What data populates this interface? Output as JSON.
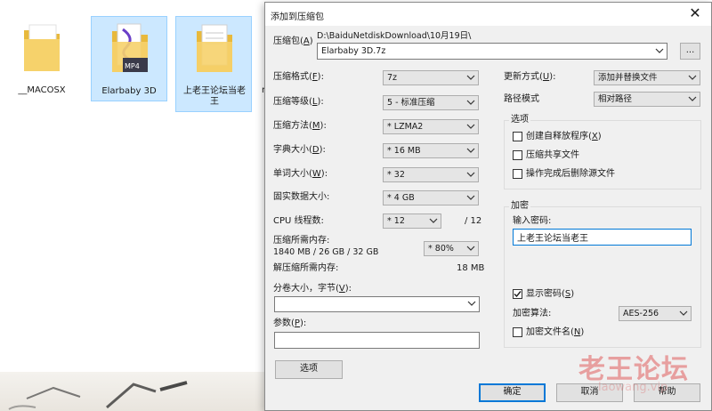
{
  "explorer": {
    "files": [
      {
        "name": "__MACOSX",
        "icon": "folder-icon"
      },
      {
        "name": "Elarbaby 3D",
        "icon": "mp4-folder-icon"
      },
      {
        "name": "上老王论坛当老王",
        "icon": "document-folder-icon"
      }
    ],
    "partial_text": "r"
  },
  "dialog": {
    "title": "添加到压缩包",
    "close_glyph": "✕",
    "archive": {
      "label": "压缩包(",
      "label_key": "A",
      "label_end": ")",
      "path": "D:\\BaiduNetdiskDownload\\10月19日\\",
      "filename": "Elarbaby 3D.7z",
      "browse_label": "..."
    },
    "left": {
      "format": {
        "label": "压缩格式(",
        "key": "F",
        "end": "):",
        "value": "7z"
      },
      "level": {
        "label": "压缩等级(",
        "key": "L",
        "end": "):",
        "value": "5 - 标准压缩"
      },
      "method": {
        "label": "压缩方法(",
        "key": "M",
        "end": "):",
        "value": "* LZMA2"
      },
      "dict": {
        "label": "字典大小(",
        "key": "D",
        "end": "):",
        "value": "* 16 MB"
      },
      "word": {
        "label": "单词大小(",
        "key": "W",
        "end": "):",
        "value": "* 32"
      },
      "solid": {
        "label": "固实数据大小:",
        "value": "* 4 GB"
      },
      "cpu": {
        "label": "CPU 线程数:",
        "value": "* 12",
        "max": "/ 12"
      },
      "mem_compress": {
        "label": "压缩所需内存:",
        "detail": "1840 MB / 26 GB / 32 GB",
        "value": "* 80%"
      },
      "mem_decompress": {
        "label": "解压缩所需内存:",
        "value": "18 MB"
      },
      "split": {
        "label": "分卷大小，字节(",
        "key": "V",
        "end": "):",
        "value": ""
      },
      "params": {
        "label": "参数(",
        "key": "P",
        "end": "):",
        "value": ""
      },
      "options_button": "选项"
    },
    "right": {
      "update": {
        "label": "更新方式(",
        "key": "U",
        "end": "):",
        "value": "添加并替换文件"
      },
      "path_mode": {
        "label": "路径模式",
        "value": "相对路径"
      },
      "options": {
        "title": "选项",
        "sfx": {
          "label": "创建自释放程序(",
          "key": "X",
          "end": ")",
          "checked": false
        },
        "shared": {
          "label": "压缩共享文件",
          "checked": false
        },
        "delete": {
          "label": "操作完成后删除源文件",
          "checked": false
        }
      },
      "encryption": {
        "title": "加密",
        "password_label": "输入密码:",
        "password_value": "上老王论坛当老王",
        "show_password": {
          "label": "显示密码(",
          "key": "S",
          "end": ")",
          "checked": true
        },
        "method_label": "加密算法:",
        "method_value": "AES-256",
        "encrypt_names": {
          "label": "加密文件名(",
          "key": "N",
          "end": ")",
          "checked": false
        }
      }
    },
    "buttons": {
      "ok": "确定",
      "cancel": "取消",
      "help": "帮助"
    }
  },
  "watermark": {
    "main": "老王论坛",
    "sub": "laowang.vip"
  },
  "colors": {
    "selection": "#cce8ff",
    "selection_border": "#99d1ff",
    "focus": "#0078d7",
    "dialog_bg": "#f0f0f0",
    "watermark": "#dc3c3c"
  }
}
